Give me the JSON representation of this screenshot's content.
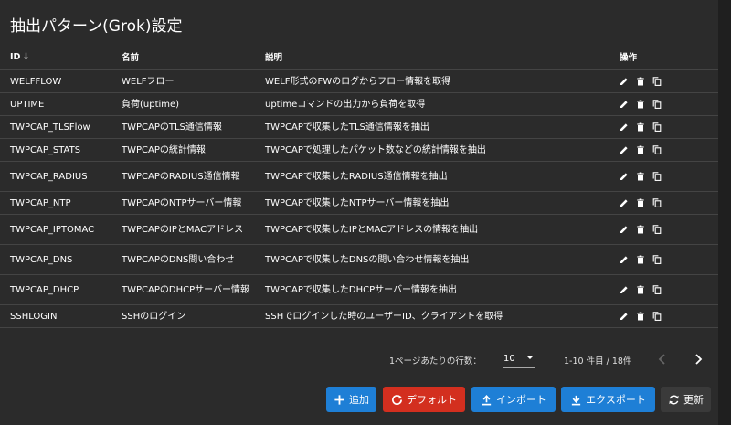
{
  "page": {
    "title": "抽出パターン(Grok)設定"
  },
  "table": {
    "headers": {
      "id": "ID",
      "sort_indicator": "↓",
      "name": "名前",
      "description": "説明",
      "actions": "操作"
    },
    "rows": [
      {
        "id": "WELFFLOW",
        "name": "WELFフロー",
        "description": "WELF形式のFWのログからフロー情報を取得"
      },
      {
        "id": "UPTIME",
        "name": "負荷(uptime)",
        "description": "uptimeコマンドの出力から負荷を取得"
      },
      {
        "id": "TWPCAP_TLSFlow",
        "name": "TWPCAPのTLS通信情報",
        "description": "TWPCAPで収集したTLS通信情報を抽出"
      },
      {
        "id": "TWPCAP_STATS",
        "name": "TWPCAPの統計情報",
        "description": "TWPCAPで処理したパケット数などの統計情報を抽出"
      },
      {
        "id": "TWPCAP_RADIUS",
        "name": "TWPCAPのRADIUS通信情報",
        "description": "TWPCAPで収集したRADIUS通信情報を抽出"
      },
      {
        "id": "TWPCAP_NTP",
        "name": "TWPCAPのNTPサーバー情報",
        "description": "TWPCAPで収集したNTPサーバー情報を抽出"
      },
      {
        "id": "TWPCAP_IPTOMAC",
        "name": "TWPCAPのIPとMACアドレス",
        "description": "TWPCAPで収集したIPとMACアドレスの情報を抽出"
      },
      {
        "id": "TWPCAP_DNS",
        "name": "TWPCAPのDNS問い合わせ",
        "description": "TWPCAPで収集したDNSの問い合わせ情報を抽出"
      },
      {
        "id": "TWPCAP_DHCP",
        "name": "TWPCAPのDHCPサーバー情報",
        "description": "TWPCAPで収集したDHCPサーバー情報を抽出"
      },
      {
        "id": "SSHLOGIN",
        "name": "SSHのログイン",
        "description": "SSHでログインした時のユーザーID、クライアントを取得"
      }
    ],
    "row_actions": [
      "edit-icon",
      "delete-icon",
      "copy-icon"
    ]
  },
  "pagination": {
    "rows_per_page_label": "1ページあたりの行数：",
    "rows_per_page": "10",
    "range": "1-10 件目 / 18件"
  },
  "buttons": {
    "add": "追加",
    "default": "デフォルト",
    "import": "インポート",
    "export": "エクスポート",
    "refresh": "更新"
  },
  "colors": {
    "primary": "#1e7fd6",
    "danger": "#d32f1f",
    "background": "#2b2b2b"
  }
}
